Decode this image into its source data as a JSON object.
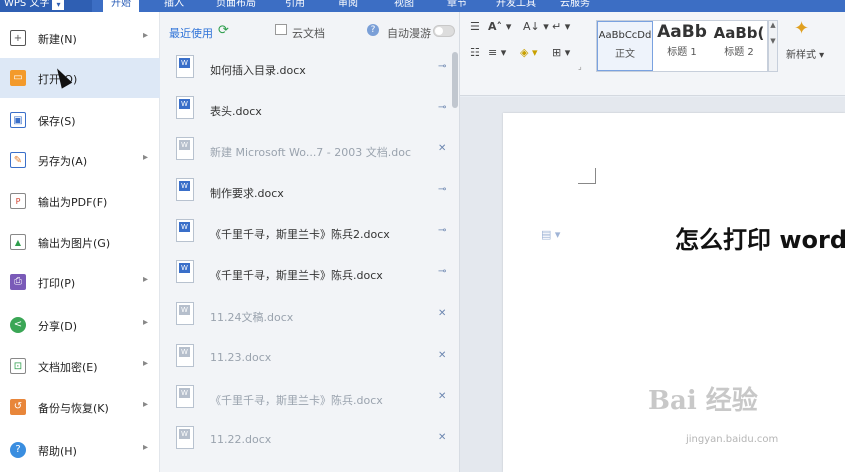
{
  "app": {
    "menu_button": "WPS 文字",
    "tabs": [
      "开始",
      "插入",
      "页面布局",
      "引用",
      "审阅",
      "视图",
      "章节",
      "开发工具",
      "云服务"
    ],
    "active_tab": "开始"
  },
  "left_menu": [
    {
      "label": "新建(N)",
      "icon": "new-doc-icon",
      "arrow": true
    },
    {
      "label": "打开(O)",
      "icon": "folder-open-icon",
      "arrow": false
    },
    {
      "label": "保存(S)",
      "icon": "save-icon",
      "arrow": false
    },
    {
      "label": "另存为(A)",
      "icon": "save-as-icon",
      "arrow": true
    },
    {
      "label": "输出为PDF(F)",
      "icon": "pdf-icon",
      "arrow": false
    },
    {
      "label": "输出为图片(G)",
      "icon": "image-export-icon",
      "arrow": false
    },
    {
      "label": "打印(P)",
      "icon": "print-icon",
      "arrow": true
    },
    {
      "label": "分享(D)",
      "icon": "share-icon",
      "arrow": true
    },
    {
      "label": "文档加密(E)",
      "icon": "encrypt-icon",
      "arrow": true
    },
    {
      "label": "备份与恢复(K)",
      "icon": "backup-icon",
      "arrow": true
    },
    {
      "label": "帮助(H)",
      "icon": "help-icon",
      "arrow": true
    }
  ],
  "recent": {
    "tab_label": "最近使用",
    "cloud_label": "云文档",
    "roaming_label": "自动漫游",
    "files": [
      {
        "name": "如何插入目录.docx",
        "dim": false,
        "pinned": true
      },
      {
        "name": "表头.docx",
        "dim": false,
        "pinned": true
      },
      {
        "name": "新建 Microsoft Wo...7 - 2003 文档.doc",
        "dim": true,
        "pinned": false
      },
      {
        "name": "制作要求.docx",
        "dim": false,
        "pinned": true
      },
      {
        "name": "《千里千寻，斯里兰卡》陈兵2.docx",
        "dim": false,
        "pinned": true
      },
      {
        "name": "《千里千寻，斯里兰卡》陈兵.docx",
        "dim": false,
        "pinned": true
      },
      {
        "name": "11.24文稿.docx",
        "dim": true,
        "pinned": false
      },
      {
        "name": "11.23.docx",
        "dim": true,
        "pinned": false
      },
      {
        "name": "《千里千寻，斯里兰卡》陈兵.docx",
        "dim": true,
        "pinned": false
      },
      {
        "name": "11.22.docx",
        "dim": true,
        "pinned": false
      }
    ]
  },
  "ribbon": {
    "styles": [
      {
        "sample": "AaBbCcDd",
        "label": "正文"
      },
      {
        "sample": "AaBb",
        "label": "标题 1"
      },
      {
        "sample": "AaBb(",
        "label": "标题 2"
      }
    ],
    "new_style_label": "新样式"
  },
  "document": {
    "heading": "怎么打印 word"
  },
  "watermark": {
    "title": "Bai 经验",
    "subtitle": "jingyan.baidu.com"
  }
}
